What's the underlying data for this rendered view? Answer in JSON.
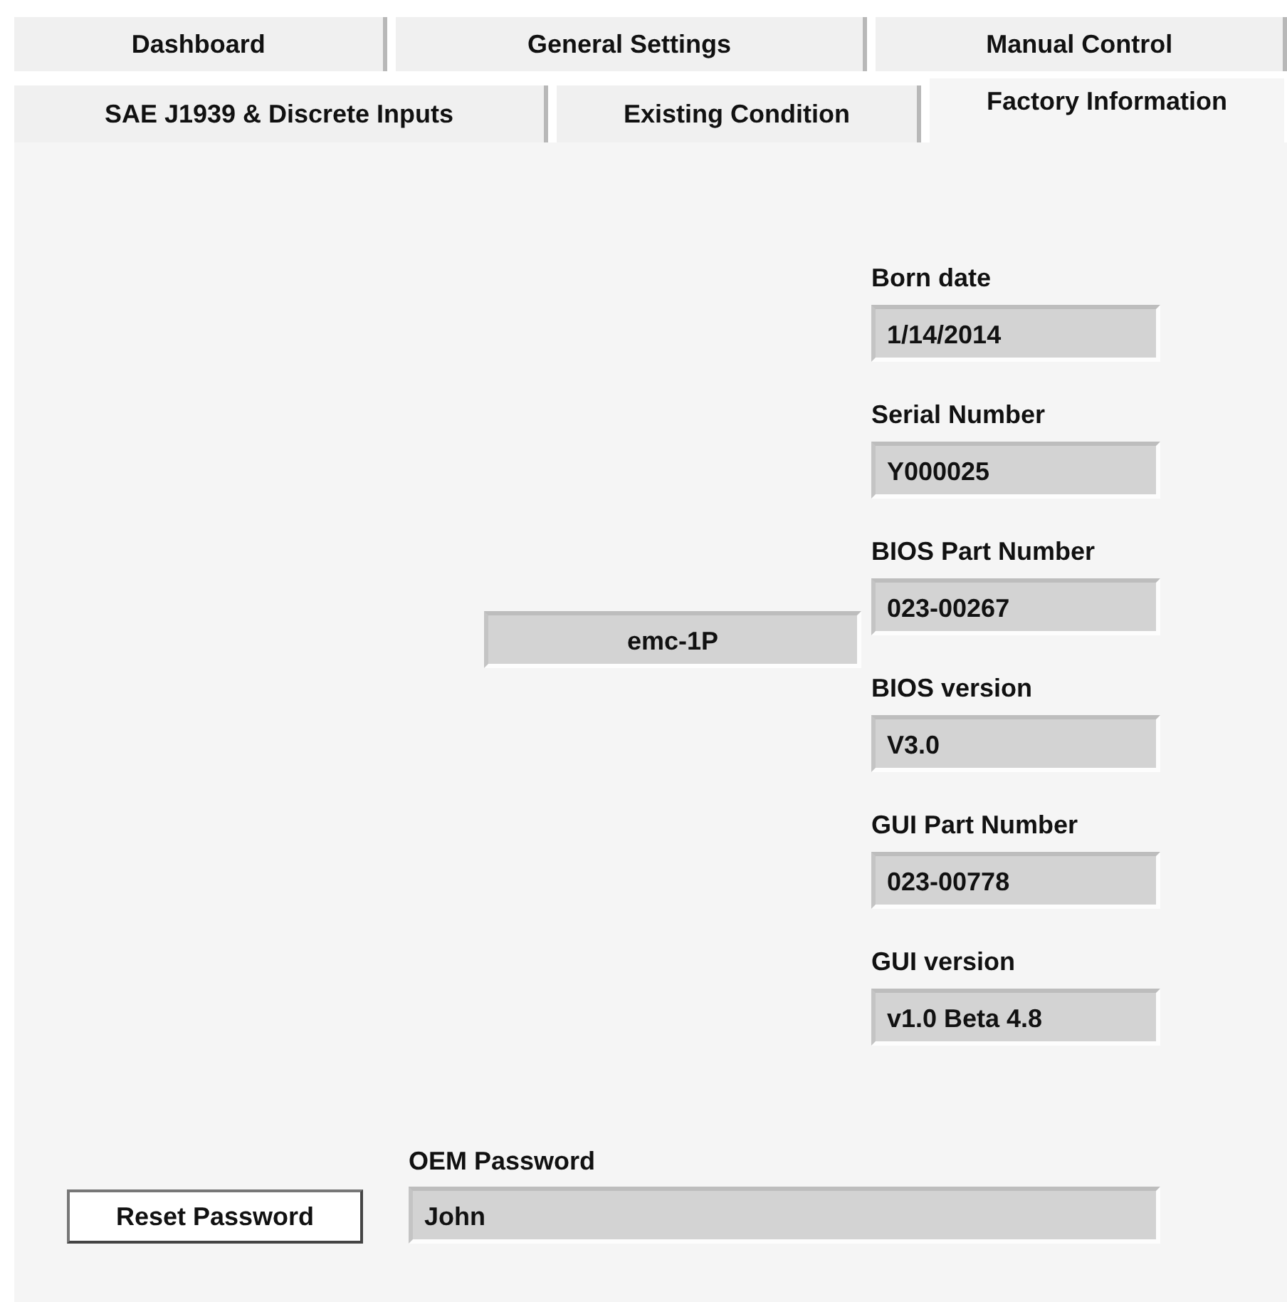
{
  "tabs": [
    [
      {
        "label": "Dashboard",
        "selected": false
      },
      {
        "label": "General Settings",
        "selected": false
      },
      {
        "label": "Manual Control",
        "selected": false
      }
    ],
    [
      {
        "label": "SAE J1939 & Discrete Inputs",
        "selected": false
      },
      {
        "label": "Existing Condition",
        "selected": false
      },
      {
        "label": "Factory Information",
        "selected": true
      }
    ]
  ],
  "model_display": "emc-1P",
  "fields": [
    {
      "label": "Born date",
      "value": "1/14/2014"
    },
    {
      "label": "Serial Number",
      "value": "Y000025"
    },
    {
      "label": "BIOS Part Number",
      "value": "023-00267"
    },
    {
      "label": "BIOS version",
      "value": "V3.0"
    },
    {
      "label": "GUI Part Number",
      "value": "023-00778"
    },
    {
      "label": "GUI version",
      "value": "v1.0 Beta 4.8"
    }
  ],
  "reset_button": "Reset Password",
  "oem_password": {
    "label": "OEM Password",
    "value": "John"
  }
}
